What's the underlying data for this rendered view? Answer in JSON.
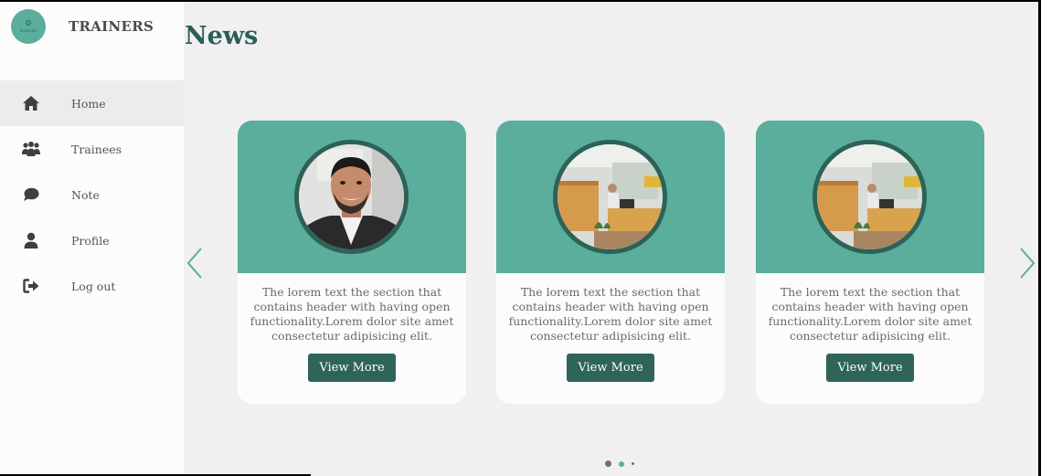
{
  "brand": {
    "logo_text": "Inspector",
    "title": "TRAINERS"
  },
  "nav": {
    "items": [
      {
        "label": "Home",
        "icon": "home-icon",
        "active": true
      },
      {
        "label": "Trainees",
        "icon": "group-icon",
        "active": false
      },
      {
        "label": "Note",
        "icon": "chat-bubble-icon",
        "active": false
      },
      {
        "label": "Profile",
        "icon": "user-icon",
        "active": false
      },
      {
        "label": "Log out",
        "icon": "logout-icon",
        "active": false
      }
    ]
  },
  "page": {
    "title": "News"
  },
  "cards": [
    {
      "image": "man-portrait",
      "text": "The lorem text the section that contains header with having open functionality.Lorem dolor site amet consectetur adipisicing elit.",
      "button": "View More"
    },
    {
      "image": "office-desk",
      "text": "The lorem text the section that contains header with having open functionality.Lorem dolor site amet consectetur adipisicing elit.",
      "button": "View More"
    },
    {
      "image": "office-desk",
      "text": "The lorem text the section that contains header with having open functionality.Lorem dolor site amet consectetur adipisicing elit.",
      "button": "View More"
    }
  ],
  "carousel": {
    "pages": 3,
    "active_page": 2
  },
  "colors": {
    "accent": "#5bad9c",
    "dark_accent": "#2e6558",
    "title": "#2b5f57"
  }
}
